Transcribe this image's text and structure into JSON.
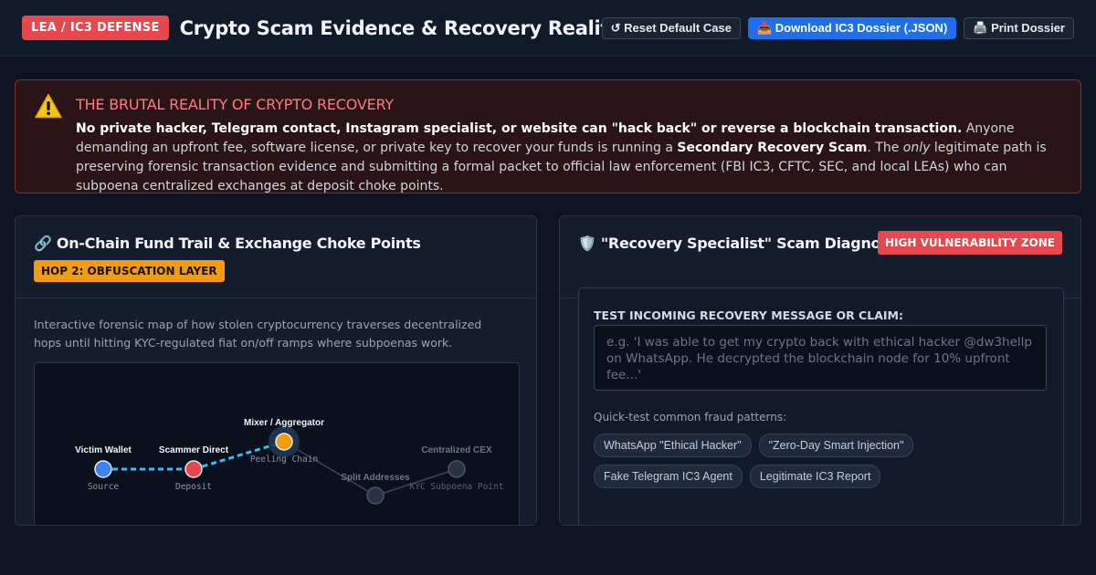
{
  "header": {
    "badge": "LEA / IC3 DEFENSE",
    "title": "Crypto Scam Evidence & Recovery Reality Navigator",
    "buttons": {
      "reset": "↺ Reset Default Case",
      "download": "📥 Download IC3 Dossier (.JSON)",
      "print": "🖨️ Print Dossier"
    }
  },
  "alert": {
    "icon": "warning-icon",
    "title": "THE BRUTAL REALITY OF CRYPTO RECOVERY",
    "bold_intro": "No private hacker, Telegram contact, Instagram specialist, or website can \"hack back\" or reverse a blockchain transaction.",
    "text_1": " Anyone demanding an upfront fee, software license, or private key to recover your funds is running a ",
    "bold_term": "Secondary Recovery Scam",
    "text_2": ". The ",
    "italic_word": "only",
    "text_3": " legitimate path is preserving forensic transaction evidence and submitting a formal packet to official law enforcement (FBI IC3, CFTC, SEC, and local LEAs) who can subpoena centralized exchanges at deposit choke points."
  },
  "fund_trail": {
    "title": "🔗 On-Chain Fund Trail & Exchange Choke Points",
    "hop_badge": "HOP 2: OBFUSCATION LAYER",
    "description": "Interactive forensic map of how stolen cryptocurrency traverses decentralized hops until hitting KYC-regulated fiat on/off ramps where subpoenas work.",
    "nodes": [
      {
        "name": "Victim Wallet",
        "sub": "Source",
        "color": "#3b82f6",
        "state": "visited"
      },
      {
        "name": "Scammer Direct",
        "sub": "Deposit",
        "color": "#e5484d",
        "state": "visited"
      },
      {
        "name": "Mixer / Aggregator",
        "sub": "Peeling Chain",
        "color": "#f39c12",
        "state": "active"
      },
      {
        "name": "Split Addresses",
        "sub": "",
        "color": "#2a3346",
        "state": "pending"
      },
      {
        "name": "Centralized CEX",
        "sub": "KYC Subpoena Point",
        "color": "#2a3346",
        "state": "pending"
      }
    ]
  },
  "diagnostic": {
    "title": "🛡️ \"Recovery Specialist\" Scam Diagnostic",
    "zone_badge": "HIGH VULNERABILITY ZONE",
    "test_label": "TEST INCOMING RECOVERY MESSAGE OR CLAIM:",
    "input_value": "",
    "input_placeholder": "e.g. 'I was able to get my crypto back with ethical hacker @dw3hellp on WhatsApp. He decrypted the blockchain node for 10% upfront fee...'",
    "quick_label": "Quick-test common fraud patterns:",
    "chips": [
      "WhatsApp \"Ethical Hacker\"",
      "\"Zero-Day Smart Injection\"",
      "Fake Telegram IC3 Agent",
      "Legitimate IC3 Report"
    ]
  }
}
